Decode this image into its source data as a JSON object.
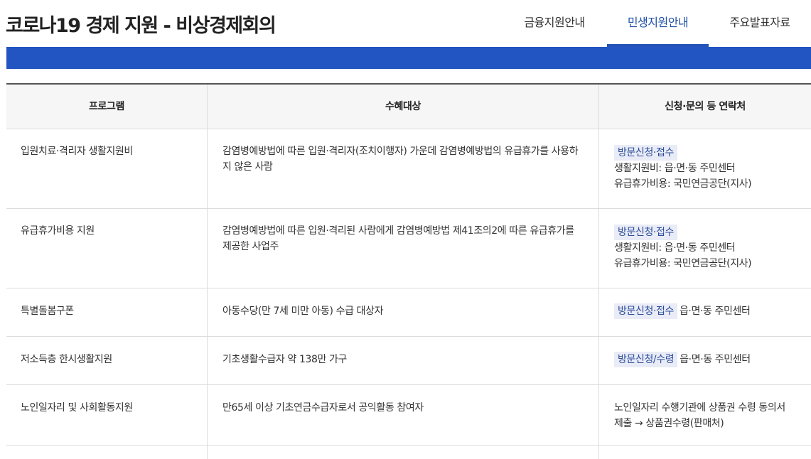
{
  "header": {
    "title": "코로나19 경제 지원 - 비상경제회의",
    "nav": [
      {
        "label": "금융지원안내"
      },
      {
        "label": "민생지원안내"
      },
      {
        "label": "주요발표자료"
      }
    ]
  },
  "table": {
    "columns": [
      "프로그램",
      "수혜대상",
      "신청·문의 등 연락처"
    ],
    "rows": [
      {
        "program": "입원치료·격리자 생활지원비",
        "target": "감염병예방법에 따른 입원·격리자(조치이행자) 가운데 감염병예방법의 유급휴가를 사용하지 않은 사람",
        "badge": "방문신청·접수",
        "contact_lines": [
          "생활지원비: 읍·면·동 주민센터",
          "유급휴가비용: 국민연금공단(지사)"
        ]
      },
      {
        "program": "유급휴가비용 지원",
        "target": "감염병예방법에 따른 입원·격리된 사람에게 감염병예방법 제41조의2에 따른 유급휴가를 제공한 사업주",
        "badge": "방문신청·접수",
        "contact_lines": [
          "생활지원비: 읍·면·동 주민센터",
          "유급휴가비용: 국민연금공단(지사)"
        ]
      },
      {
        "program": "특별돌봄구폰",
        "target": "아동수당(만 7세 미만 아동) 수급 대상자",
        "badge": "방문신청·접수",
        "contact_inline": "읍·면·동 주민센터"
      },
      {
        "program": "저소득층 한시생활지원",
        "target": "기초생활수급자 약 138만 가구",
        "badge": "방문신청/수령",
        "contact_inline": "읍·면·동 주민센터"
      },
      {
        "program": "노인일자리 및 사회활동지원",
        "target": "만65세 이상 기초연금수급자로서 공익활동 참여자",
        "contact_lines": [
          "노인일자리 수행기관에 상품권 수령 동의서",
          "제출 → 상품권수령(판매처)"
        ]
      }
    ]
  }
}
